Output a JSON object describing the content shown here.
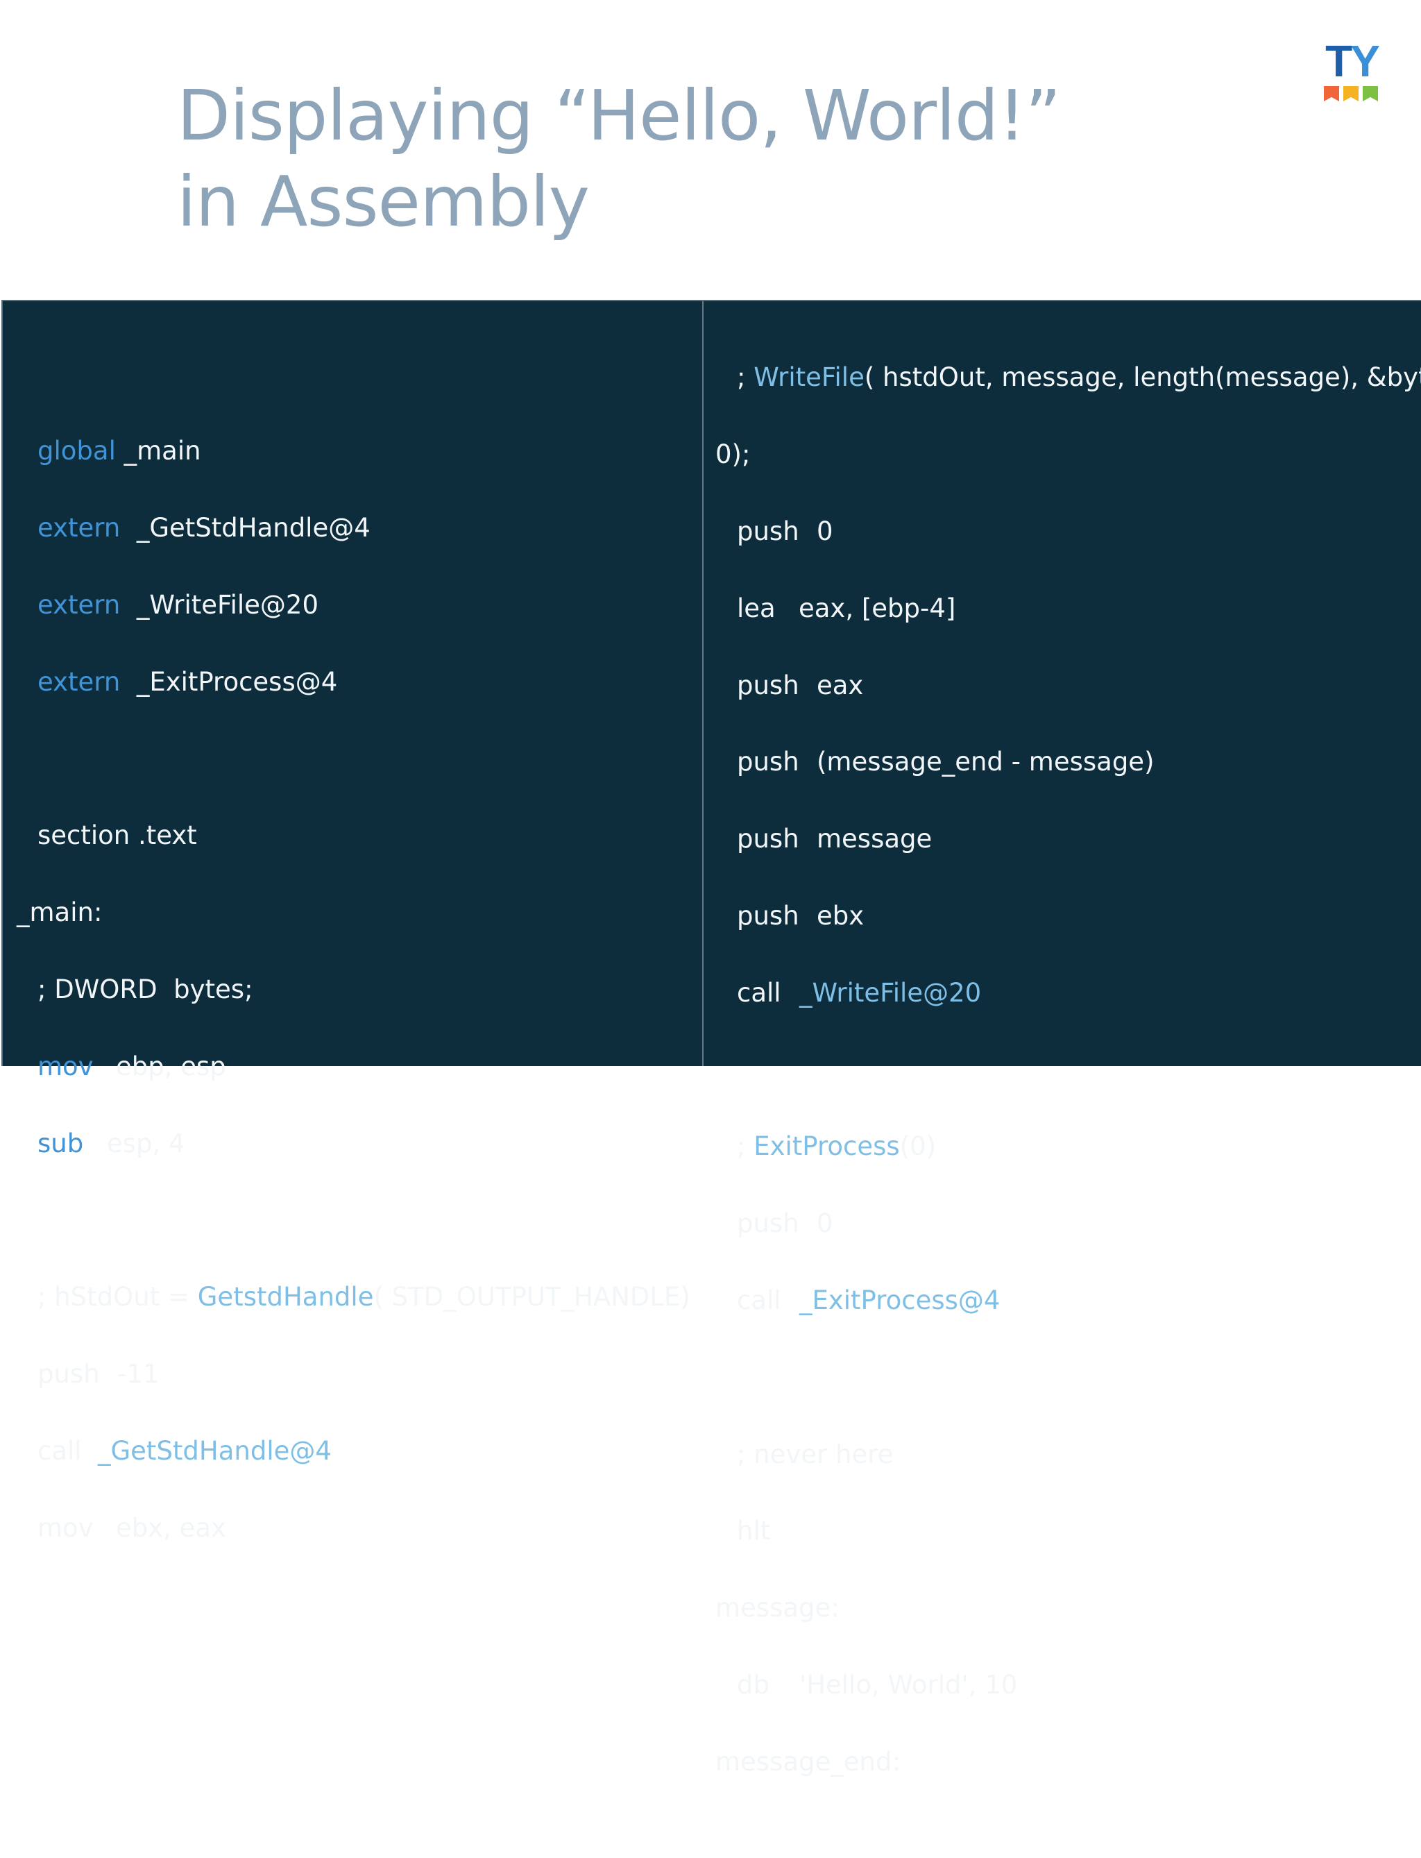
{
  "slide": {
    "title_line1": "Displaying “Hello, World!”",
    "title_line2": "in Assembly",
    "logo_text": {
      "t": "T",
      "y": "Y"
    },
    "logo_flag_colors": [
      "#f0663a",
      "#f5b323",
      "#7dc142"
    ]
  },
  "colors": {
    "panel_background": "#0d2d3d",
    "code_text": "#f2f6f8",
    "keyword": "#3f93d6",
    "function_name": "#7fbfe6",
    "title": "#8ea4b8"
  },
  "left_code": {
    "l1": {
      "kw": "global",
      "rest": " _main"
    },
    "l2": {
      "kw": "extern",
      "rest": "  _GetStdHandle@4"
    },
    "l3": {
      "kw": "extern",
      "rest": "  _WriteFile@20"
    },
    "l4": {
      "kw": "extern",
      "rest": "  _ExitProcess@4"
    },
    "l5": "section .text",
    "l6": "_main:",
    "l7": "; DWORD  bytes;",
    "l8": {
      "op": "mov",
      "args": "ebp, esp"
    },
    "l9": {
      "op": "sub",
      "args": "esp, 4"
    },
    "l10": {
      "pre": "; hStdOut = ",
      "fn": "GetstdHandle",
      "post": "( STD_OUTPUT_HANDLE)"
    },
    "l11": {
      "op": "push",
      "args": "-11"
    },
    "l12": {
      "op": "call",
      "fn": "_GetStdHandle@4"
    },
    "l13": {
      "op": "mov",
      "args": "ebx, eax"
    }
  },
  "right_code": {
    "r1": {
      "pre": "; ",
      "fn": "WriteFile",
      "post": "( hstdOut, message, length(message), &bytes,"
    },
    "r2": "0);",
    "r3": {
      "op": "push",
      "args": "0"
    },
    "r4": {
      "op": "lea",
      "args": "eax, [ebp-4]"
    },
    "r5": {
      "op": "push",
      "args": "eax"
    },
    "r6": {
      "op": "push",
      "args": "(message_end - message)"
    },
    "r7": {
      "op": "push",
      "args": "message"
    },
    "r8": {
      "op": "push",
      "args": "ebx"
    },
    "r9": {
      "op": "call",
      "fn": "_WriteFile@20"
    },
    "r10": {
      "pre": "; ",
      "fn": "ExitProcess",
      "post": "(0)"
    },
    "r11": {
      "op": "push",
      "args": "0"
    },
    "r12": {
      "op": "call",
      "fn": "_ExitProcess@4"
    },
    "r13": "; never here",
    "r14": "hlt",
    "r15": "message:",
    "r16": {
      "op": "db",
      "args": "'Hello, World', 10"
    },
    "r17": "message_end:"
  }
}
